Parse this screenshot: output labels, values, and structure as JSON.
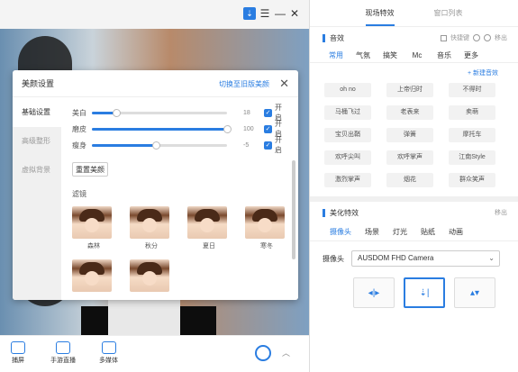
{
  "window": {
    "controls": {
      "download_icon": "⇣",
      "menu_icon": "☰",
      "min_icon": "—",
      "close_icon": "✕"
    }
  },
  "dialog": {
    "title": "美颜设置",
    "switch_link": "切换至旧版美颜",
    "side": [
      "基础设置",
      "高级整形",
      "虚拟背景"
    ],
    "sliders": [
      {
        "label": "美白",
        "value_text": "18",
        "level": 0.18,
        "check_label": "开启"
      },
      {
        "label": "磨皮",
        "value_text": "100",
        "level": 1.0,
        "check_label": "开启"
      },
      {
        "label": "瘦身",
        "value_text": "-5",
        "level": 0.47,
        "check_label": "开启"
      }
    ],
    "reset_label": "重置美颜",
    "filter_title": "滤镜",
    "filters": [
      "森林",
      "秋分",
      "夏日",
      "寒冬",
      "",
      ""
    ]
  },
  "bottom": {
    "tools": [
      "捕屏",
      "手游直播",
      "多媒体"
    ]
  },
  "right": {
    "tabs": [
      "现场特效",
      "窗口列表"
    ],
    "fx_section": {
      "title": "音效",
      "quick_key": "快捷键",
      "remove": "移出",
      "categories": [
        "常用",
        "气氛",
        "搞笑",
        "Mc",
        "音乐",
        "更多"
      ],
      "new_label": "+ 新建音效",
      "items": [
        "oh no",
        "上帝归时",
        "不得时",
        "马桶飞过",
        "老表来",
        "卖萌",
        "宝贝出鞘",
        "弹簧",
        "摩托车",
        "欢呼尖叫",
        "欢呼掌声",
        "江南Style",
        "激烈掌声",
        "烟花",
        "群众笑声"
      ]
    },
    "beauty_section": {
      "title": "美化特效",
      "remove": "移出",
      "tabs": [
        "摄像头",
        "场景",
        "灯光",
        "贴纸",
        "动画"
      ],
      "camera_label": "摄像头",
      "camera_value": "AUSDOM FHD Camera"
    }
  }
}
